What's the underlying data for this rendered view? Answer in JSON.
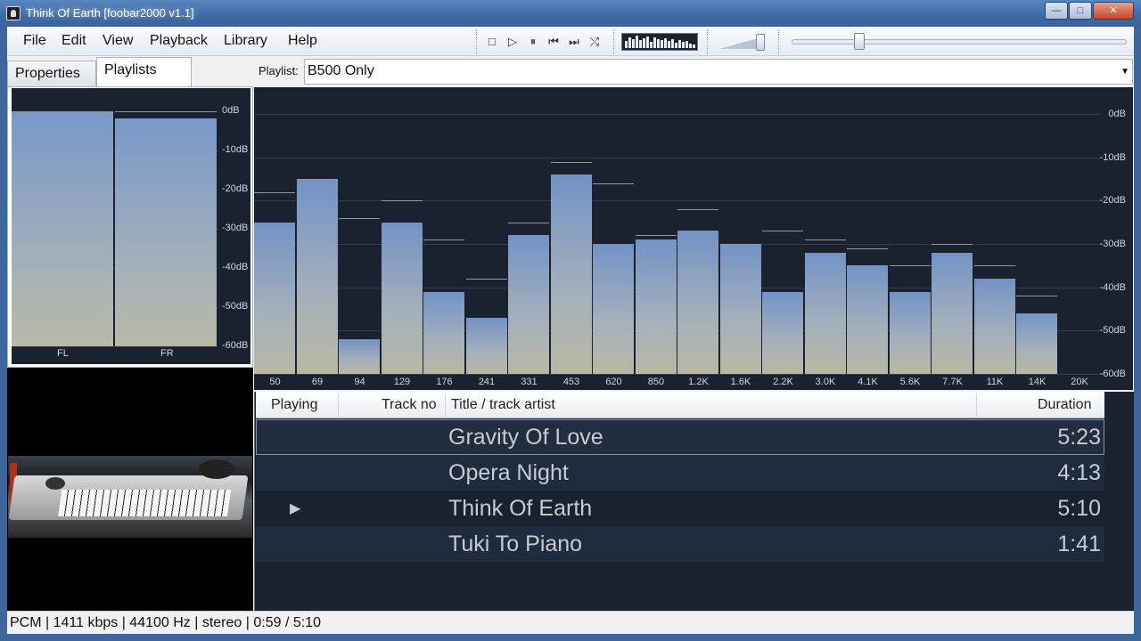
{
  "window": {
    "title": "Think Of Earth   [foobar2000 v1.1]",
    "minimize": "—",
    "maximize": "□",
    "close": "✕"
  },
  "menu": [
    "File",
    "Edit",
    "View",
    "Playback",
    "Library",
    "Help"
  ],
  "toolbar": {
    "buttons": [
      {
        "name": "stop-button",
        "glyph": "□"
      },
      {
        "name": "play-button",
        "glyph": "▷"
      },
      {
        "name": "pause-button",
        "glyph": "⏸"
      },
      {
        "name": "previous-button",
        "glyph": "⏮"
      },
      {
        "name": "next-button",
        "glyph": "⏭"
      },
      {
        "name": "random-button",
        "glyph": "⤭"
      }
    ],
    "volume_level": 0.85,
    "seek_fraction": 0.19
  },
  "left_tabs": {
    "properties": "Properties",
    "playlists": "Playlists"
  },
  "peak_meter": {
    "db_labels": [
      "0dB",
      "-10dB",
      "-20dB",
      "-30dB",
      "-40dB",
      "-50dB",
      "-60dB"
    ],
    "channels": [
      {
        "label": "FL",
        "level_db": -0.3,
        "peak_db": 0.0
      },
      {
        "label": "FR",
        "level_db": -1.8,
        "peak_db": 0.0
      }
    ]
  },
  "playlist_selector": {
    "label": "Playlist:",
    "value": "B500 Only"
  },
  "spectrum": {
    "db_labels": [
      "0dB",
      "-10dB",
      "-20dB",
      "-30dB",
      "-40dB",
      "-50dB",
      "-60dB"
    ],
    "bands": [
      {
        "freq": "50",
        "level": -25,
        "peak": -18
      },
      {
        "freq": "69",
        "level": -15,
        "peak": -15
      },
      {
        "freq": "94",
        "level": -52,
        "peak": -24
      },
      {
        "freq": "129",
        "level": -25,
        "peak": -20
      },
      {
        "freq": "176",
        "level": -41,
        "peak": -29
      },
      {
        "freq": "241",
        "level": -47,
        "peak": -38
      },
      {
        "freq": "331",
        "level": -28,
        "peak": -25
      },
      {
        "freq": "453",
        "level": -14,
        "peak": -11
      },
      {
        "freq": "620",
        "level": -30,
        "peak": -16
      },
      {
        "freq": "850",
        "level": -29,
        "peak": -28
      },
      {
        "freq": "1.2K",
        "level": -27,
        "peak": -22
      },
      {
        "freq": "1.6K",
        "level": -30,
        "peak": -30
      },
      {
        "freq": "2.2K",
        "level": -41,
        "peak": -27
      },
      {
        "freq": "3.0K",
        "level": -32,
        "peak": -29
      },
      {
        "freq": "4.1K",
        "level": -35,
        "peak": -31
      },
      {
        "freq": "5.6K",
        "level": -41,
        "peak": -35
      },
      {
        "freq": "7.7K",
        "level": -32,
        "peak": -30
      },
      {
        "freq": "11K",
        "level": -38,
        "peak": -35
      },
      {
        "freq": "14K",
        "level": -46,
        "peak": -42
      },
      {
        "freq": "20K",
        "level": -60,
        "peak": -60
      }
    ]
  },
  "playlist_view": {
    "columns": {
      "playing": "Playing",
      "track_no": "Track no",
      "title": "Title / track artist",
      "duration": "Duration"
    },
    "rows": [
      {
        "title": "Gravity Of Love",
        "duration": "5:23",
        "playing": "",
        "focused": true
      },
      {
        "title": "Opera Night",
        "duration": "4:13",
        "playing": "",
        "focused": false
      },
      {
        "title": "Think Of Earth",
        "duration": "5:10",
        "playing": "▶",
        "focused": false
      },
      {
        "title": "Tuki To Piano",
        "duration": "1:41",
        "playing": "",
        "focused": false
      }
    ]
  },
  "status": "PCM | 1411 kbps | 44100 Hz | stereo | 0:59 / 5:10"
}
